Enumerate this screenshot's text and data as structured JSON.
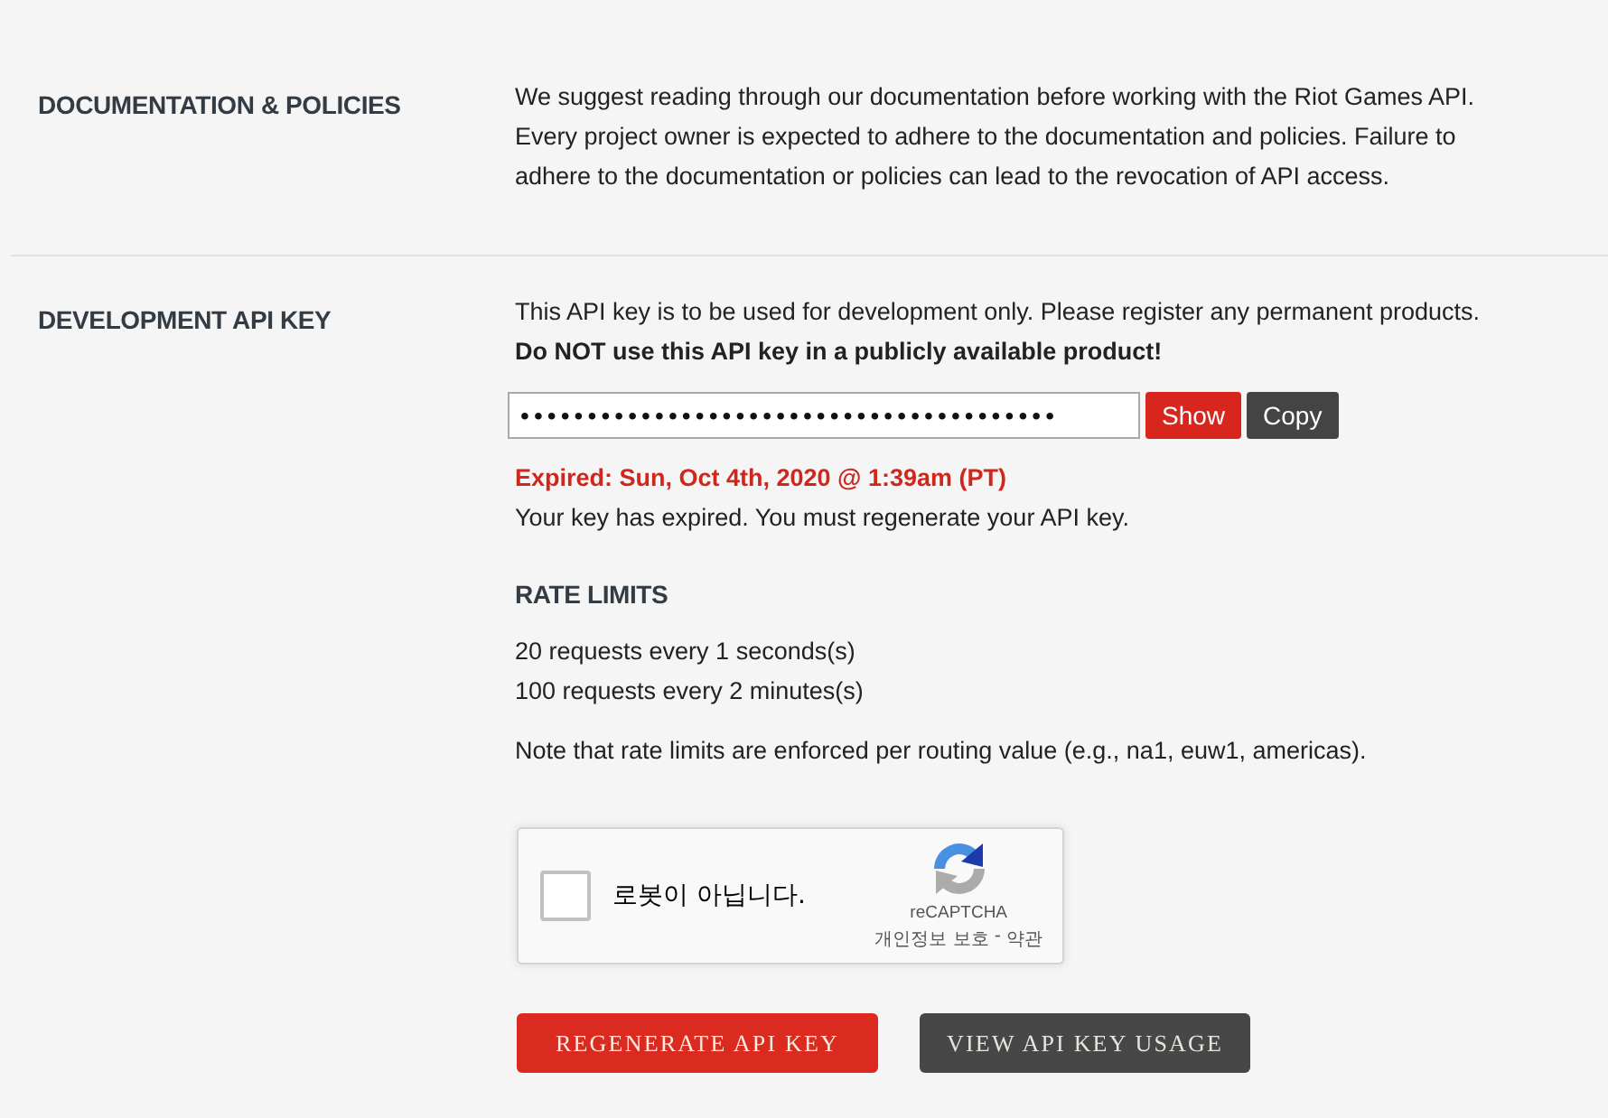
{
  "sections": [
    {
      "kind": "text",
      "heading": "DOCUMENTATION & POLICIES",
      "paragraph": "We suggest reading through our documentation before working with the Riot Games API. Every project owner is expected to adhere to the documentation and policies. Failure to adhere to the documentation or policies can lead to the revocation of API access."
    },
    {
      "kind": "api_key",
      "heading": "DEVELOPMENT API KEY",
      "intro": "This API key is to be used for development only. Please register any permanent products.",
      "warning": "Do NOT use this API key in a publicly available product!",
      "key_field": {
        "value": "••••••••••••••••••••••••••••••••••••••••"
      },
      "key_buttons": [
        {
          "label": "Show",
          "kind": "primary"
        },
        {
          "label": "Copy",
          "kind": "secondary"
        }
      ],
      "expiry": "Expired: Sun, Oct 4th, 2020 @ 1:39am (PT)",
      "expiry_message": "Your key has expired. You must regenerate your API key.",
      "rate_limits": {
        "heading": "RATE LIMITS",
        "limits": [
          "20 requests every 1 seconds(s)",
          "100 requests every 2 minutes(s)"
        ],
        "note": "Note that rate limits are enforced per routing value (e.g., na1, euw1, americas)."
      },
      "captcha": {
        "label": "로봇이 아닙니다.",
        "checked": false,
        "brand": "reCAPTCHA",
        "links": [
          "개인정보 보호",
          "약관"
        ],
        "link_separator": "-"
      },
      "actions": [
        {
          "label": "REGENERATE API KEY",
          "kind": "primary"
        },
        {
          "label": "VIEW API KEY USAGE",
          "kind": "secondary"
        }
      ]
    }
  ]
}
